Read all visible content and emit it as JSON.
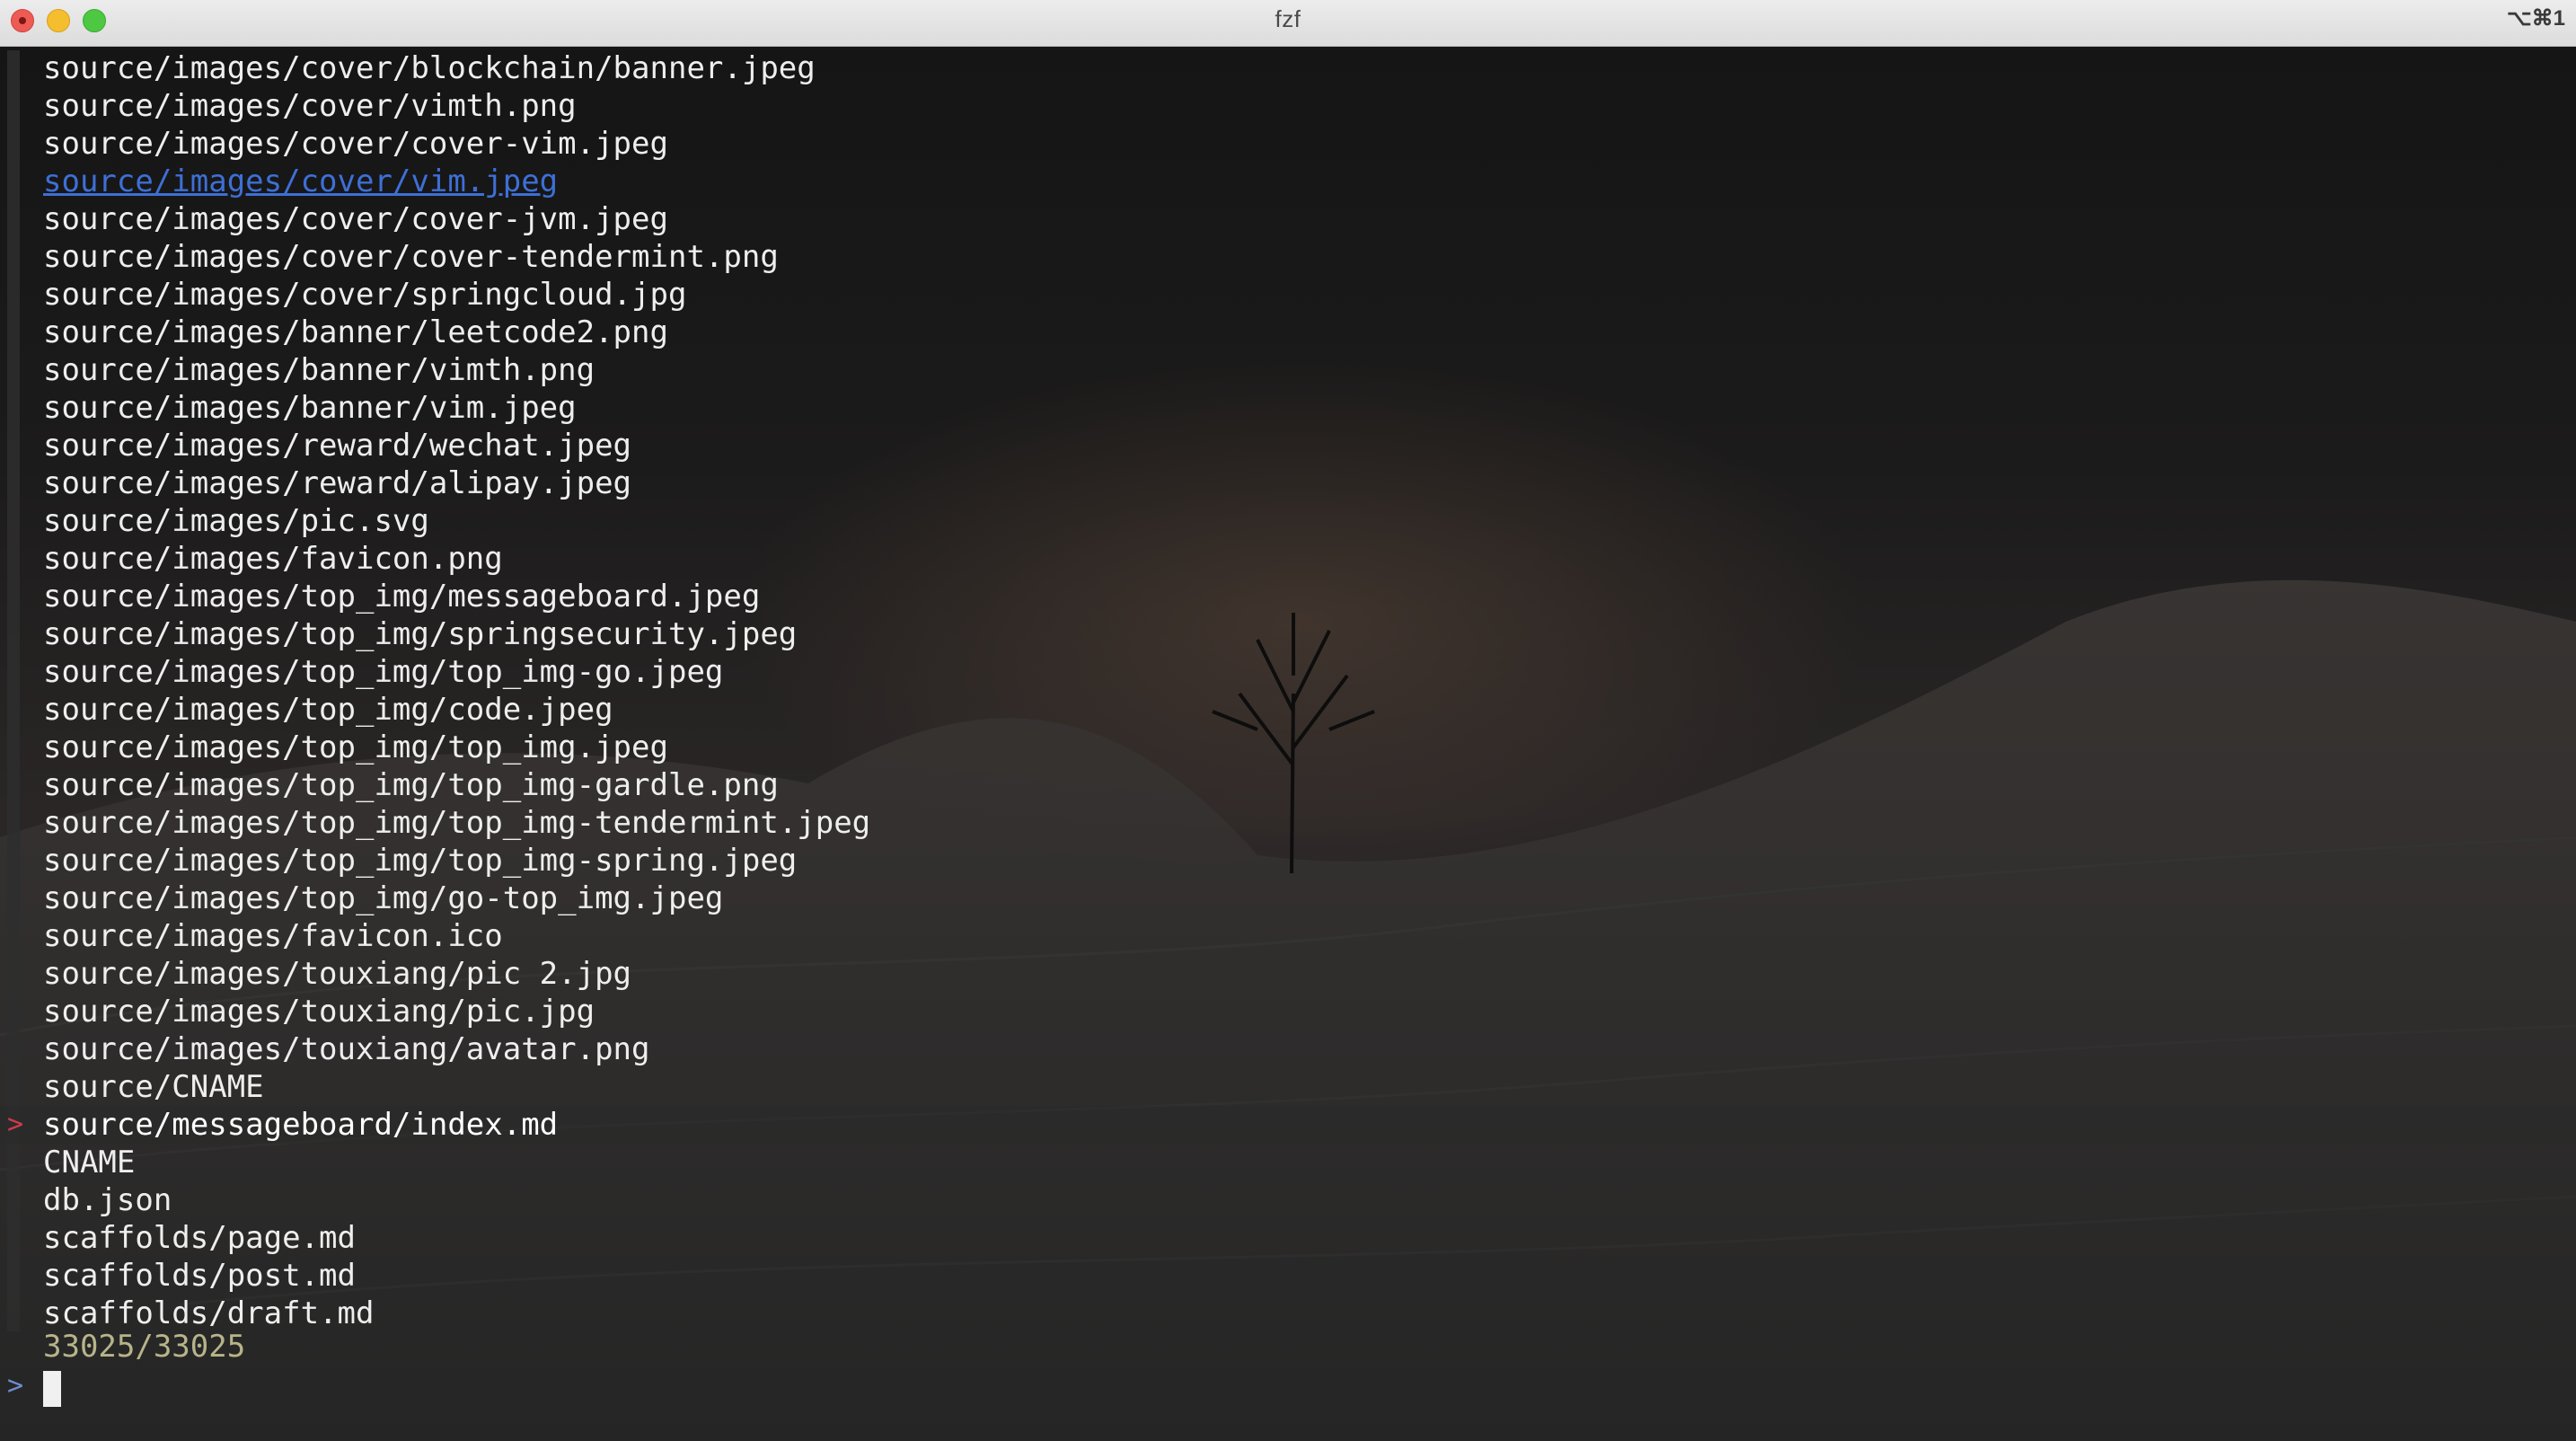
{
  "window": {
    "title": "fzf",
    "shortcut": "⌥⌘1"
  },
  "results": [
    {
      "path": "source/images/cover/blockchain/banner.jpeg"
    },
    {
      "path": "source/images/cover/vimth.png"
    },
    {
      "path": "source/images/cover/cover-vim.jpeg"
    },
    {
      "path": "source/images/cover/vim.jpeg",
      "state": "hover"
    },
    {
      "path": "source/images/cover/cover-jvm.jpeg"
    },
    {
      "path": "source/images/cover/cover-tendermint.png"
    },
    {
      "path": "source/images/cover/springcloud.jpg"
    },
    {
      "path": "source/images/banner/leetcode2.png"
    },
    {
      "path": "source/images/banner/vimth.png"
    },
    {
      "path": "source/images/banner/vim.jpeg"
    },
    {
      "path": "source/images/reward/wechat.jpeg"
    },
    {
      "path": "source/images/reward/alipay.jpeg"
    },
    {
      "path": "source/images/pic.svg"
    },
    {
      "path": "source/images/favicon.png"
    },
    {
      "path": "source/images/top_img/messageboard.jpeg"
    },
    {
      "path": "source/images/top_img/springsecurity.jpeg"
    },
    {
      "path": "source/images/top_img/top_img-go.jpeg"
    },
    {
      "path": "source/images/top_img/code.jpeg"
    },
    {
      "path": "source/images/top_img/top_img.jpeg"
    },
    {
      "path": "source/images/top_img/top_img-gardle.png"
    },
    {
      "path": "source/images/top_img/top_img-tendermint.jpeg"
    },
    {
      "path": "source/images/top_img/top_img-spring.jpeg"
    },
    {
      "path": "source/images/top_img/go-top_img.jpeg"
    },
    {
      "path": "source/images/favicon.ico"
    },
    {
      "path": "source/images/touxiang/pic 2.jpg"
    },
    {
      "path": "source/images/touxiang/pic.jpg"
    },
    {
      "path": "source/images/touxiang/avatar.png"
    },
    {
      "path": "source/CNAME"
    },
    {
      "path": "source/messageboard/index.md",
      "state": "current",
      "pointer": ">"
    },
    {
      "path": "CNAME"
    },
    {
      "path": "db.json"
    },
    {
      "path": "scaffolds/page.md"
    },
    {
      "path": "scaffolds/post.md"
    },
    {
      "path": "scaffolds/draft.md"
    }
  ],
  "status": {
    "match_count": "33025/33025"
  },
  "prompt": {
    "symbol": ">",
    "query": ""
  },
  "colors": {
    "pointer": "#d13b4d",
    "hover_link": "#3d6fd6",
    "info": "#b8b48a",
    "prompt": "#6e8ccf"
  }
}
